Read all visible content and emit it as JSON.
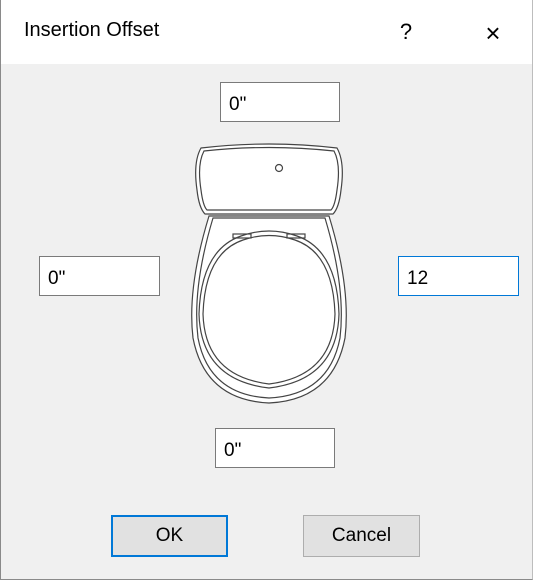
{
  "window": {
    "title": "Insertion Offset",
    "help_label": "?",
    "close_label": "×",
    "close_icon": "close-icon",
    "help_icon": "help-icon"
  },
  "offsets": {
    "top": "0\"",
    "left": "0\"",
    "right": "12",
    "bottom": "0\""
  },
  "buttons": {
    "ok_label": "OK",
    "cancel_label": "Cancel"
  },
  "colors": {
    "accent": "#0078d7",
    "dialog_bg": "#f0f0f0",
    "button_bg": "#e1e1e1"
  },
  "illustration": "toilet-top-view-icon"
}
